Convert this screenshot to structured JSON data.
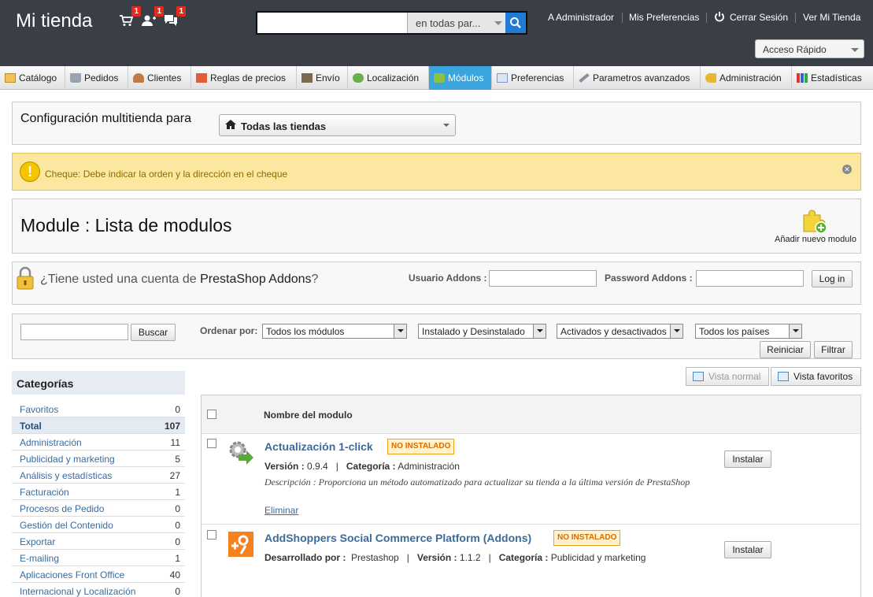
{
  "header": {
    "shop_name": "Mi tienda",
    "badges": {
      "orders": "1",
      "customers": "1",
      "messages": "1"
    },
    "search": {
      "placeholder": "",
      "scope": "en todas par..."
    },
    "links": [
      "A Administrador",
      "Mis Preferencias",
      "Cerrar Sesión",
      "Ver Mi Tienda"
    ],
    "quick_access": "Acceso Rápido"
  },
  "tabs": [
    {
      "label": "Catálogo",
      "icon": "folder-icon"
    },
    {
      "label": "Pedidos",
      "icon": "cart-icon"
    },
    {
      "label": "Clientes",
      "icon": "user-icon"
    },
    {
      "label": "Reglas de precios",
      "icon": "tag-icon"
    },
    {
      "label": "Envío",
      "icon": "truck-icon"
    },
    {
      "label": "Localización",
      "icon": "globe-icon"
    },
    {
      "label": "Módulos",
      "icon": "puzzle-icon",
      "active": true
    },
    {
      "label": "Preferencias",
      "icon": "form-icon"
    },
    {
      "label": "Parametros avanzados",
      "icon": "wrench-icon"
    },
    {
      "label": "Administración",
      "icon": "key-icon"
    },
    {
      "label": "Estadísticas",
      "icon": "bar-chart-icon"
    }
  ],
  "multishop": {
    "label": "Configuración multitienda para",
    "value": "Todas las tiendas"
  },
  "warning": {
    "text": "Cheque: Debe indicar la orden y la dirección en el cheque"
  },
  "page": {
    "title": "Module : Lista de modulos",
    "add_module": "Añadir nuevo modulo"
  },
  "addons": {
    "prompt_pre": "¿Tiene usted una cuenta de ",
    "prompt_brand": "PrestaShop Addons",
    "prompt_post": "?",
    "user_label": "Usuario Addons :",
    "password_label": "Password Addons :",
    "login": "Log in"
  },
  "filters": {
    "search_button": "Buscar",
    "sort_label": "Ordenar por:",
    "selects": [
      "Todos los módulos",
      "Instalado y Desinstalado",
      "Activados y desactivados",
      "Todos los países"
    ],
    "reset": "Reiniciar",
    "filter": "Filtrar"
  },
  "categories": {
    "title": "Categorías",
    "items": [
      {
        "label": "Favoritos",
        "count": "0"
      },
      {
        "label": "Total",
        "count": "107"
      },
      {
        "label": "Administración",
        "count": "11"
      },
      {
        "label": "Publicidad y marketing",
        "count": "5"
      },
      {
        "label": "Análisis y estadísticas",
        "count": "27"
      },
      {
        "label": "Facturación",
        "count": "1"
      },
      {
        "label": "Procesos de Pedido",
        "count": "0"
      },
      {
        "label": "Gestión del Contenido",
        "count": "0"
      },
      {
        "label": "Exportar",
        "count": "0"
      },
      {
        "label": "E-mailing",
        "count": "1"
      },
      {
        "label": "Aplicaciones Front Office",
        "count": "40"
      },
      {
        "label": "Internacional y Localización",
        "count": "0"
      }
    ]
  },
  "views": {
    "normal": "Vista normal",
    "favorites": "Vista favoritos"
  },
  "table": {
    "header": "Nombre del modulo",
    "modules": [
      {
        "name": "Actualización 1-click",
        "status": "NO INSTALADO",
        "version_label": "Versión :",
        "version": "0.9.4",
        "category_label": "Categoría :",
        "category": "Administración",
        "description": "Descripción : Proporciona un método automatizado para actualizar su tienda a la última versión de PrestaShop",
        "delete": "Eliminar",
        "install": "Instalar"
      },
      {
        "name": "AddShoppers Social Commerce Platform (Addons)",
        "status": "NO INSTALADO",
        "dev_label": "Desarrollado por :",
        "dev": "Prestashop",
        "version_label": "Versión :",
        "version": "1.1.2",
        "category_label": "Categoría :",
        "category": "Publicidad y marketing",
        "install": "Instalar"
      }
    ]
  }
}
